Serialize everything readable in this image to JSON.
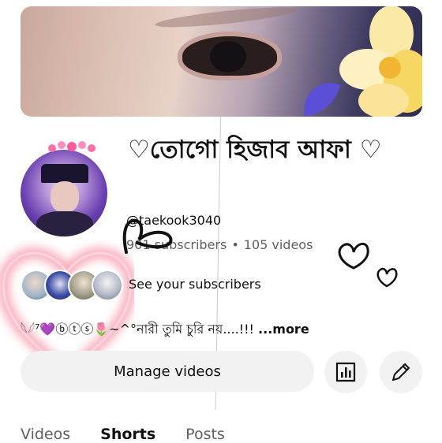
{
  "channel": {
    "title": "♡তোগো হিজাব আফা ♡",
    "handle": "@taekook3040",
    "subscribers": "901 subscribers",
    "separator": "•",
    "videos": "105 videos",
    "see_subscribers": "See your subscribers",
    "description_prefix": "𓆩𓆪⁷💜ⓑⓣⓢ🌷~^°নারী তুমি চুরি নয়....!!!",
    "description_more": "...more"
  },
  "actions": {
    "manage_videos": "Manage videos",
    "analytics_icon": "bar-chart-icon",
    "edit_icon": "pencil-icon"
  },
  "tabs": [
    {
      "label": "Videos",
      "active": false
    },
    {
      "label": "Shorts",
      "active": true
    },
    {
      "label": "Posts",
      "active": false
    }
  ],
  "colors": {
    "button_bg": "#f2f2f2",
    "secondary_text": "#606060",
    "primary_text": "#0f0f0f",
    "heart_glow": "#f48aa0"
  }
}
